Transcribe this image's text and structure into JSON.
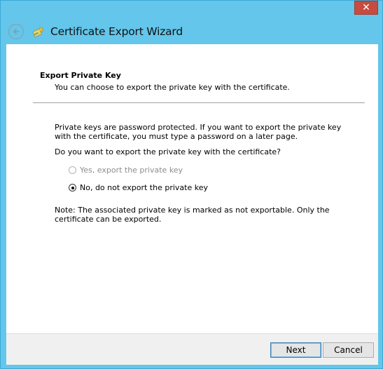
{
  "window": {
    "title": "Certificate Export Wizard",
    "close_glyph": "✕"
  },
  "header": {
    "title": "Export Private Key",
    "subtitle": "You can choose to export the private key with the certificate."
  },
  "body": {
    "paragraph1": "Private keys are password protected. If you want to export the private key with the certificate, you must type a password on a later page.",
    "question": "Do you want to export the private key with the certificate?",
    "options": [
      {
        "label": "Yes, export the private key",
        "selected": false,
        "enabled": false
      },
      {
        "label": "No, do not export the private key",
        "selected": true,
        "enabled": true
      }
    ],
    "note": "Note: The associated private key is marked as not exportable. Only the certificate can be exported."
  },
  "footer": {
    "next_label": "Next",
    "cancel_label": "Cancel"
  },
  "icons": {
    "back": "back-arrow-icon",
    "wizard": "certificate-wizard-icon",
    "close": "close-icon"
  },
  "colors": {
    "titlebar": "#63c6ea",
    "close_button": "#c74b3f",
    "default_button_border": "#3c7fb1"
  }
}
